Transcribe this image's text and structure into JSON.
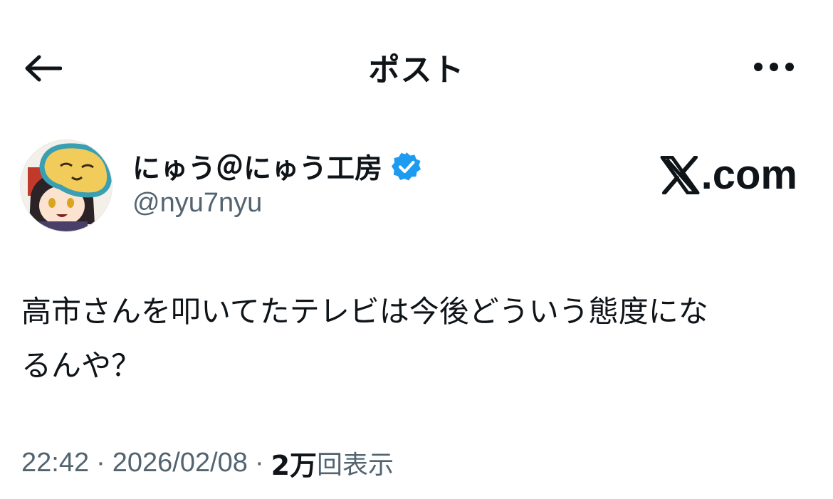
{
  "header": {
    "title": "ポスト",
    "back_icon": "arrow-left-icon",
    "more_icon": "more-horizontal-icon"
  },
  "author": {
    "display_name": "にゅう＠にゅう工房",
    "handle": "@nyu7nyu",
    "verified": true,
    "verified_color": "#1d9bf0"
  },
  "watermark": {
    "text": ".com",
    "logo_icon": "x-logo-icon"
  },
  "post": {
    "text": "高市さんを叩いてたテレビは今後どういう態度にな\nるんや？"
  },
  "meta": {
    "time": "22:42",
    "separator": "·",
    "date": "2026/02/08",
    "views_count": "2万",
    "views_label": "回表示"
  },
  "colors": {
    "text_primary": "#0f1419",
    "text_secondary": "#536471",
    "accent": "#1d9bf0"
  }
}
